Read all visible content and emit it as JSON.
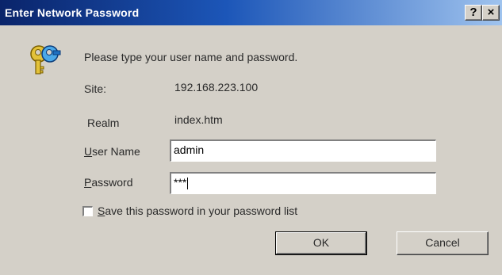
{
  "window": {
    "title": "Enter Network Password",
    "help_label": "?",
    "close_label": "×"
  },
  "prompt": "Please type your user name and password.",
  "site": {
    "label": "Site:",
    "value": "192.168.223.100"
  },
  "realm": {
    "label": "Realm",
    "value": "index.htm"
  },
  "user_name": {
    "label_first": "U",
    "label_rest": "ser Name",
    "value": "admin"
  },
  "password": {
    "label_first": "P",
    "label_rest": "assword",
    "masked_value": "***"
  },
  "save_password": {
    "label_first": "S",
    "label_rest": "ave this password in your password list",
    "checked": false
  },
  "buttons": {
    "ok": "OK",
    "cancel": "Cancel"
  },
  "icons": {
    "dialog_icon": "key-icon"
  },
  "colors": {
    "titlebar_start": "#0a246a",
    "titlebar_end": "#9fc3ee",
    "dialog_bg": "#d4d0c8"
  }
}
